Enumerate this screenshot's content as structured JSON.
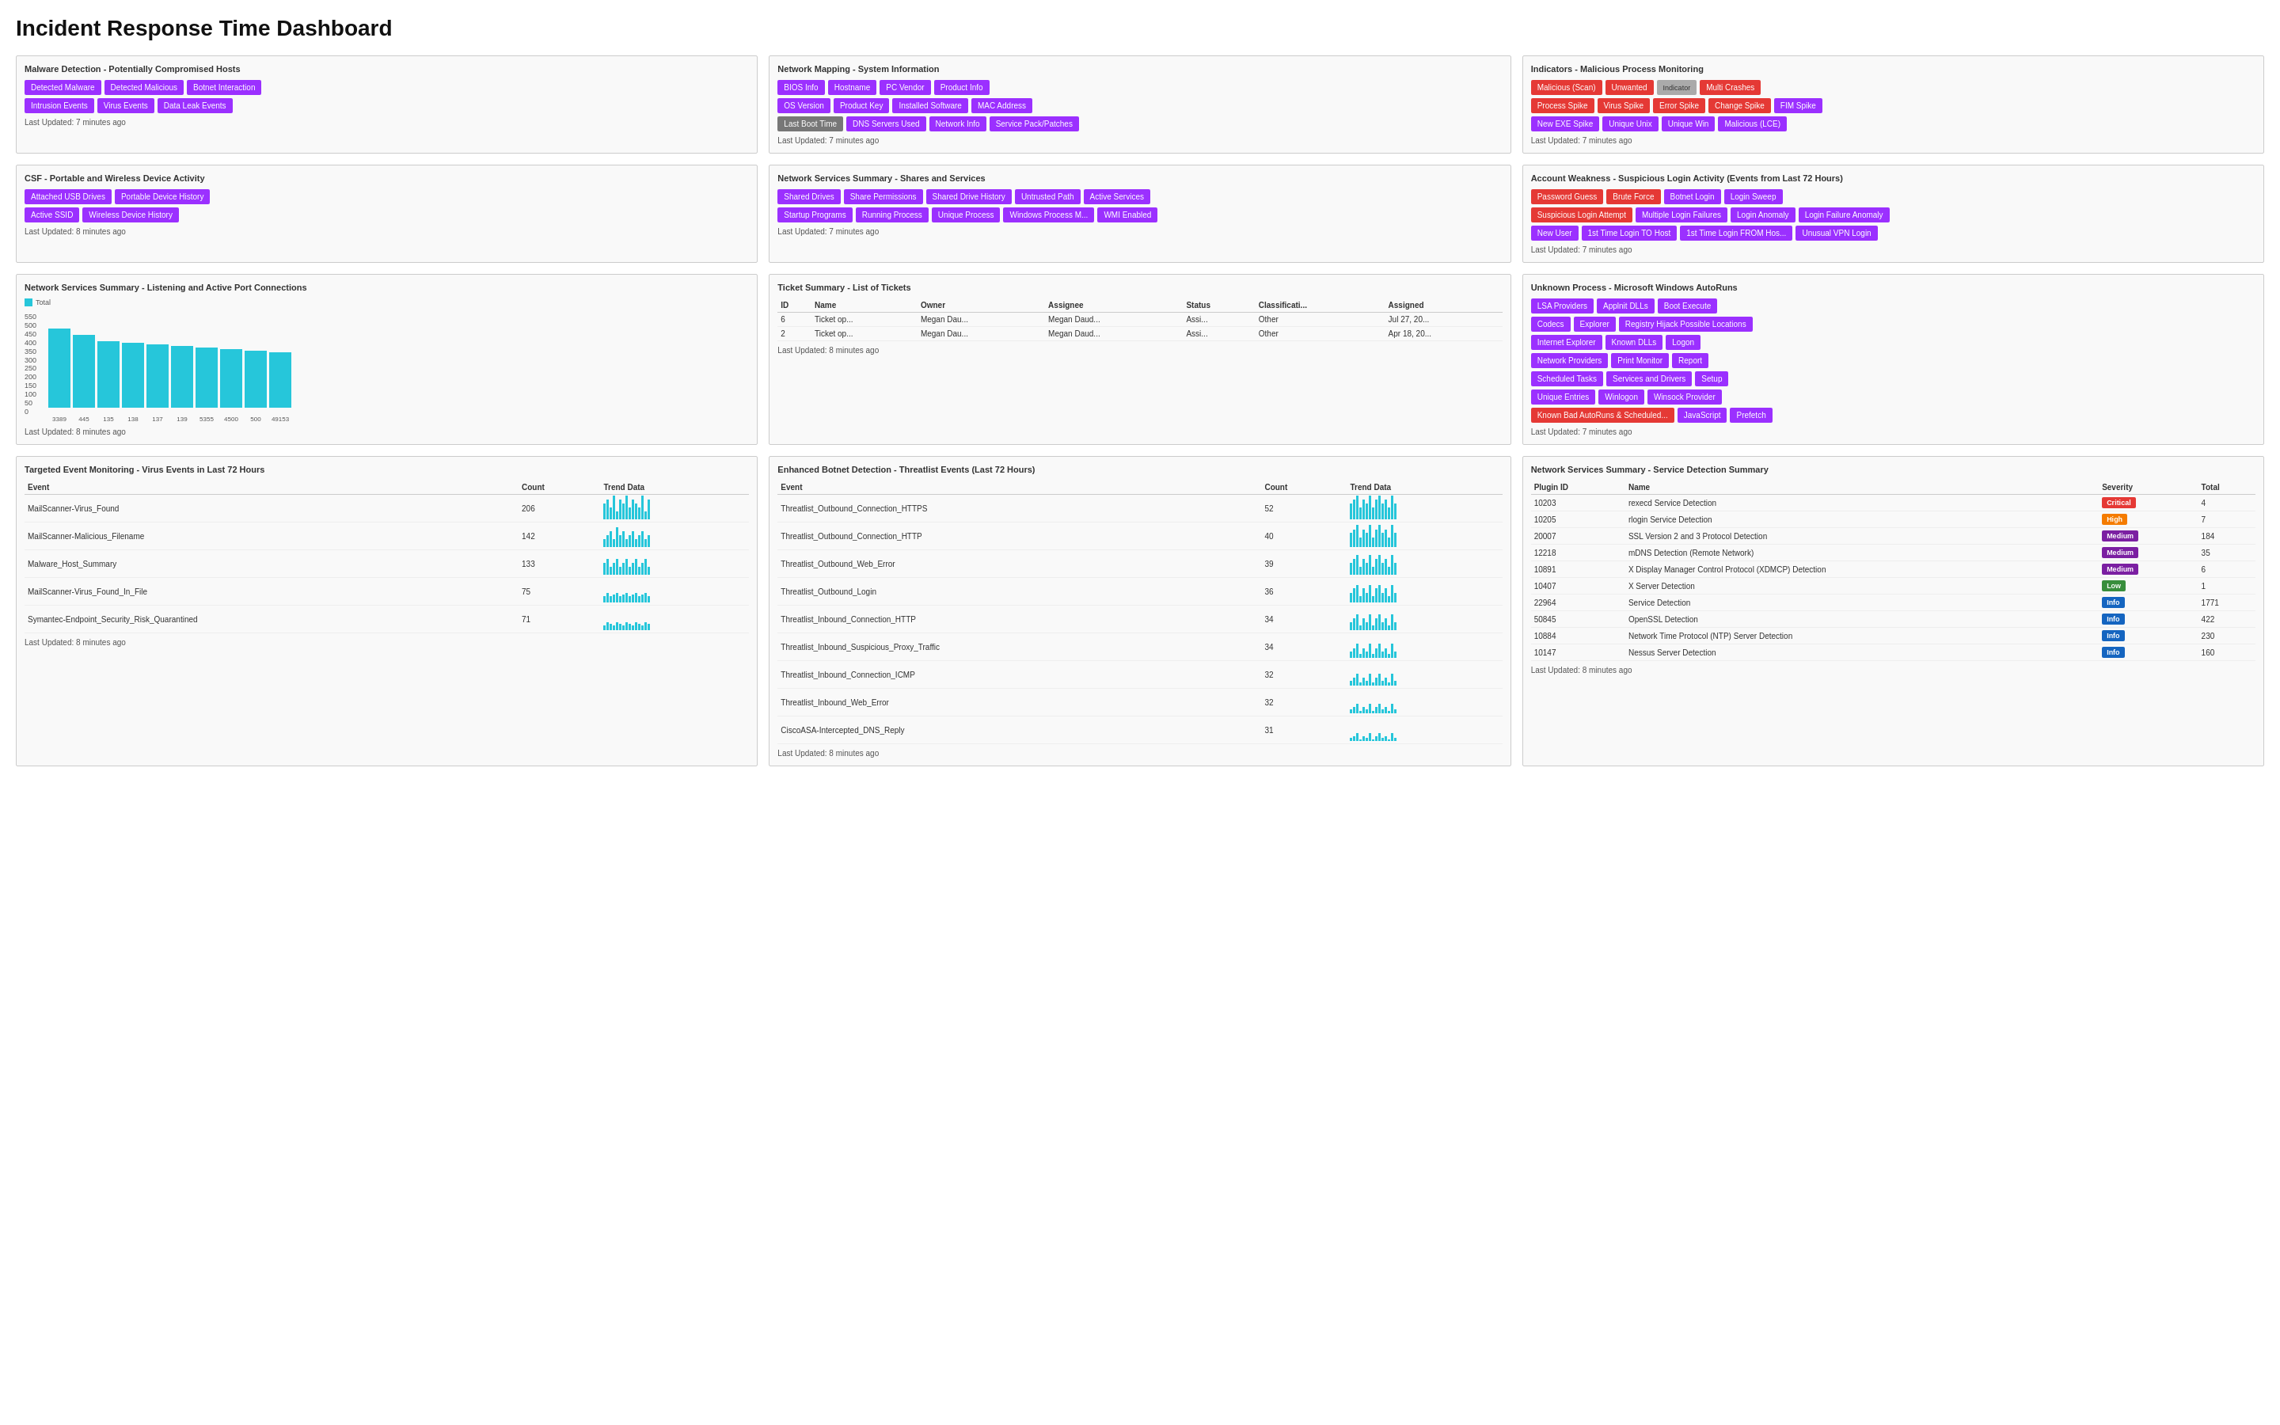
{
  "title": "Incident Response Time Dashboard",
  "panels": {
    "malware_detection": {
      "title": "Malware Detection - Potentially Compromised Hosts",
      "buttons_row1": [
        "Detected Malware",
        "Detected Malicious",
        "Botnet Interaction"
      ],
      "buttons_row2": [
        "Intrusion Events",
        "Virus Events",
        "Data Leak Events"
      ],
      "last_updated": "Last Updated: 7 minutes ago"
    },
    "csf": {
      "title": "CSF - Portable and Wireless Device Activity",
      "buttons_row1": [
        "Attached USB Drives",
        "Portable Device History"
      ],
      "buttons_row2": [
        "Active SSID",
        "Wireless Device History"
      ],
      "last_updated": "Last Updated: 8 minutes ago"
    },
    "network_mapping": {
      "title": "Network Mapping - System Information",
      "buttons_row1": [
        "BIOS Info",
        "Hostname",
        "PC Vendor",
        "Product Info"
      ],
      "buttons_row2": [
        "OS Version",
        "Product Key",
        "Installed Software",
        "MAC Address"
      ],
      "buttons_row3": [
        "Last Boot Time",
        "DNS Servers Used",
        "Network Info",
        "Service Pack/Patches"
      ],
      "last_updated": "Last Updated: 7 minutes ago"
    },
    "network_services_shares": {
      "title": "Network Services Summary - Shares and Services",
      "buttons_row1": [
        "Shared Drives",
        "Share Permissions",
        "Shared Drive History",
        "Untrusted Path",
        "Active Services"
      ],
      "buttons_row2": [
        "Startup Programs",
        "Running Process",
        "Unique Process",
        "Windows Process M...",
        "WMI Enabled"
      ],
      "last_updated": "Last Updated: 7 minutes ago"
    },
    "indicators": {
      "title": "Indicators - Malicious Process Monitoring",
      "row1": [
        "Malicious (Scan)",
        "Unwanted",
        "Indicator",
        "Multi Crashes"
      ],
      "row2": [
        "Process Spike",
        "Virus Spike",
        "Error Spike",
        "Change Spike",
        "FIM Spike"
      ],
      "row3": [
        "New EXE Spike",
        "Unique Unix",
        "Unique Win",
        "Malicious (LCE)"
      ],
      "last_updated": "Last Updated: 7 minutes ago"
    },
    "account_weakness": {
      "title": "Account Weakness - Suspicious Login Activity (Events from Last 72 Hours)",
      "row1": [
        "Password Guess",
        "Brute Force",
        "Botnet Login",
        "Login Sweep"
      ],
      "row2": [
        "Suspicious Login Attempt",
        "Multiple Login Failures",
        "Login Anomaly",
        "Login Failure Anomaly"
      ],
      "row3": [
        "New User",
        "1st Time Login TO Host",
        "1st Time Login FROM Hos...",
        "Unusual VPN Login"
      ],
      "last_updated": "Last Updated: 7 minutes ago"
    },
    "port_connections": {
      "title": "Network Services Summary - Listening and Active Port Connections",
      "chart_legend": "Total",
      "bars": [
        {
          "label": "3389",
          "value": 540,
          "height": 100
        },
        {
          "label": "445",
          "value": 480,
          "height": 92
        },
        {
          "label": "135",
          "value": 440,
          "height": 84
        },
        {
          "label": "138",
          "value": 430,
          "height": 82
        },
        {
          "label": "137",
          "value": 420,
          "height": 80
        },
        {
          "label": "139",
          "value": 410,
          "height": 78
        },
        {
          "label": "5355",
          "value": 400,
          "height": 76
        },
        {
          "label": "4500",
          "value": 390,
          "height": 74
        },
        {
          "label": "500",
          "value": 380,
          "height": 72
        },
        {
          "label": "49153",
          "value": 370,
          "height": 70
        }
      ],
      "y_labels": [
        "550",
        "500",
        "450",
        "400",
        "350",
        "300",
        "250",
        "200",
        "150",
        "100",
        "50",
        "0"
      ],
      "last_updated": "Last Updated: 8 minutes ago"
    },
    "ticket_summary": {
      "title": "Ticket Summary - List of Tickets",
      "columns": [
        "ID",
        "Name",
        "Owner",
        "Assignee",
        "Status",
        "Classificati...",
        "Assigned"
      ],
      "rows": [
        {
          "id": "6",
          "name": "Ticket op...",
          "owner": "Megan Dau...",
          "assignee": "Megan Daud...",
          "status": "Assi...",
          "classification": "Other",
          "assigned": "Jul 27, 20..."
        },
        {
          "id": "2",
          "name": "Ticket op...",
          "owner": "Megan Dau...",
          "assignee": "Megan Daud...",
          "status": "Assi...",
          "classification": "Other",
          "assigned": "Apr 18, 20..."
        }
      ],
      "last_updated": "Last Updated: 8 minutes ago"
    },
    "unknown_process": {
      "title": "Unknown Process - Microsoft Windows AutoRuns",
      "row1": [
        "LSA Providers",
        "Applnit DLLs",
        "Boot Execute"
      ],
      "row2": [
        "Codecs",
        "Explorer",
        "Registry Hijack Possible Locations"
      ],
      "row3": [
        "Internet Explorer",
        "Known DLLs",
        "Logon"
      ],
      "row4": [
        "Network Providers",
        "Print Monitor",
        "Report"
      ],
      "row5": [
        "Scheduled Tasks",
        "Services and Drivers",
        "Setup"
      ],
      "row6": [
        "Unique Entries",
        "Winlogon",
        "Winsock Provider"
      ],
      "row7_red": [
        "Known Bad AutoRuns & Schedule..."
      ],
      "row7_purple": [
        "JavaScript",
        "Prefetch"
      ],
      "last_updated": "Last Updated: 7 minutes ago"
    },
    "virus_events": {
      "title": "Targeted Event Monitoring - Virus Events in Last 72 Hours",
      "columns": [
        "Event",
        "Count",
        "Trend Data"
      ],
      "rows": [
        {
          "event": "MailScanner-Virus_Found",
          "count": "206",
          "heights": [
            20,
            25,
            15,
            30,
            10,
            25,
            20,
            30,
            15,
            25,
            20,
            15,
            30,
            10,
            25
          ]
        },
        {
          "event": "MailScanner-Malicious_Filename",
          "count": "142",
          "heights": [
            10,
            15,
            20,
            10,
            25,
            15,
            20,
            10,
            15,
            20,
            10,
            15,
            20,
            10,
            15
          ]
        },
        {
          "event": "Malware_Host_Summary",
          "count": "133",
          "heights": [
            15,
            20,
            10,
            15,
            20,
            10,
            15,
            20,
            10,
            15,
            20,
            10,
            15,
            20,
            10
          ]
        },
        {
          "event": "MailScanner-Virus_Found_In_File",
          "count": "75",
          "heights": [
            8,
            12,
            8,
            10,
            12,
            8,
            10,
            12,
            8,
            10,
            12,
            8,
            10,
            12,
            8
          ]
        },
        {
          "event": "Symantec-Endpoint_Security_Risk_Quarantined",
          "count": "71",
          "heights": [
            6,
            10,
            8,
            6,
            10,
            8,
            6,
            10,
            8,
            6,
            10,
            8,
            6,
            10,
            8
          ]
        }
      ],
      "last_updated": "Last Updated: 8 minutes ago"
    },
    "botnet_detection": {
      "title": "Enhanced Botnet Detection - Threatlist Events (Last 72 Hours)",
      "columns": [
        "Event",
        "Count",
        "Trend Data"
      ],
      "rows": [
        {
          "event": "Threatlist_Outbound_Connection_HTTPS",
          "count": "52",
          "heights": [
            20,
            25,
            30,
            15,
            25,
            20,
            30,
            15,
            25,
            30,
            20,
            25,
            15,
            30,
            20
          ]
        },
        {
          "event": "Threatlist_Outbound_Connection_HTTP",
          "count": "40",
          "heights": [
            18,
            22,
            28,
            12,
            22,
            18,
            28,
            12,
            22,
            28,
            18,
            22,
            12,
            28,
            18
          ]
        },
        {
          "event": "Threatlist_Outbound_Web_Error",
          "count": "39",
          "heights": [
            15,
            20,
            25,
            10,
            20,
            15,
            25,
            10,
            20,
            25,
            15,
            20,
            10,
            25,
            15
          ]
        },
        {
          "event": "Threatlist_Outbound_Login",
          "count": "36",
          "heights": [
            12,
            18,
            22,
            8,
            18,
            12,
            22,
            8,
            18,
            22,
            12,
            18,
            8,
            22,
            12
          ]
        },
        {
          "event": "Threatlist_Inbound_Connection_HTTP",
          "count": "34",
          "heights": [
            10,
            15,
            20,
            6,
            15,
            10,
            20,
            6,
            15,
            20,
            10,
            15,
            6,
            20,
            10
          ]
        },
        {
          "event": "Threatlist_Inbound_Suspicious_Proxy_Traffic",
          "count": "34",
          "heights": [
            8,
            12,
            18,
            5,
            12,
            8,
            18,
            5,
            12,
            18,
            8,
            12,
            5,
            18,
            8
          ]
        },
        {
          "event": "Threatlist_Inbound_Connection_ICMP",
          "count": "32",
          "heights": [
            6,
            10,
            15,
            4,
            10,
            6,
            15,
            4,
            10,
            15,
            6,
            10,
            4,
            15,
            6
          ]
        },
        {
          "event": "Threatlist_Inbound_Web_Error",
          "count": "32",
          "heights": [
            5,
            8,
            12,
            3,
            8,
            5,
            12,
            3,
            8,
            12,
            5,
            8,
            3,
            12,
            5
          ]
        },
        {
          "event": "CiscoASA-Intercepted_DNS_Reply",
          "count": "31",
          "heights": [
            4,
            6,
            10,
            2,
            6,
            4,
            10,
            2,
            6,
            10,
            4,
            6,
            2,
            10,
            4
          ]
        }
      ],
      "last_updated": "Last Updated: 8 minutes ago"
    },
    "service_detection": {
      "title": "Network Services Summary - Service Detection Summary",
      "columns": [
        "Plugin ID",
        "Name",
        "Severity",
        "Total"
      ],
      "rows": [
        {
          "plugin_id": "10203",
          "name": "rexecd Service Detection",
          "severity": "Critical",
          "severity_class": "critical",
          "total": "4"
        },
        {
          "plugin_id": "10205",
          "name": "rlogin Service Detection",
          "severity": "High",
          "severity_class": "high",
          "total": "7"
        },
        {
          "plugin_id": "20007",
          "name": "SSL Version 2 and 3 Protocol Detection",
          "severity": "Medium",
          "severity_class": "medium",
          "total": "184"
        },
        {
          "plugin_id": "12218",
          "name": "mDNS Detection (Remote Network)",
          "severity": "Medium",
          "severity_class": "medium",
          "total": "35"
        },
        {
          "plugin_id": "10891",
          "name": "X Display Manager Control Protocol (XDMCP) Detection",
          "severity": "Medium",
          "severity_class": "medium",
          "total": "6"
        },
        {
          "plugin_id": "10407",
          "name": "X Server Detection",
          "severity": "Low",
          "severity_class": "low",
          "total": "1"
        },
        {
          "plugin_id": "22964",
          "name": "Service Detection",
          "severity": "Info",
          "severity_class": "info",
          "total": "1771"
        },
        {
          "plugin_id": "50845",
          "name": "OpenSSL Detection",
          "severity": "Info",
          "severity_class": "info",
          "total": "422"
        },
        {
          "plugin_id": "10884",
          "name": "Network Time Protocol (NTP) Server Detection",
          "severity": "Info",
          "severity_class": "info",
          "total": "230"
        },
        {
          "plugin_id": "10147",
          "name": "Nessus Server Detection",
          "severity": "Info",
          "severity_class": "info",
          "total": "160"
        }
      ],
      "last_updated": "Last Updated: 8 minutes ago"
    }
  }
}
